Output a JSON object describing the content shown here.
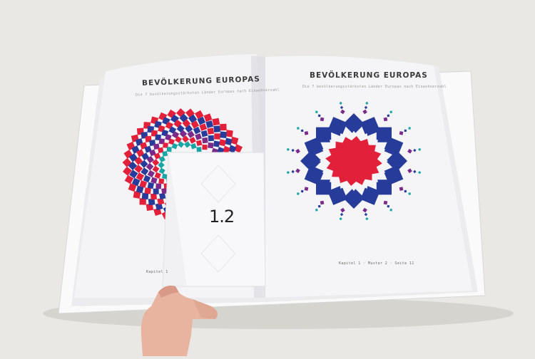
{
  "photo": {
    "colors": {
      "background": "#e9e8e4",
      "paper": "#f4f4f6",
      "red": "#e3203a",
      "blue": "#273c9a",
      "purple": "#7b2a8a",
      "teal": "#1aa5a5",
      "skin": "#e8b4a0"
    }
  },
  "book": {
    "left_page": {
      "title": "BEVÖLKERUNG EUROPAS",
      "subtitle": "Die 7 bevölkerungsstärksten Länder Europas nach Einwohnerzahl",
      "footer": "Kapitel 1"
    },
    "right_page": {
      "title": "BEVÖLKERUNG EUROPAS",
      "subtitle": "Die 7 bevölkerungsstärksten Länder Europas nach Einwohnerzahl",
      "footer": "Kapitel 1  ·  Muster 2  ·  Seite 11"
    },
    "insert_card": {
      "number": "1.2"
    }
  }
}
